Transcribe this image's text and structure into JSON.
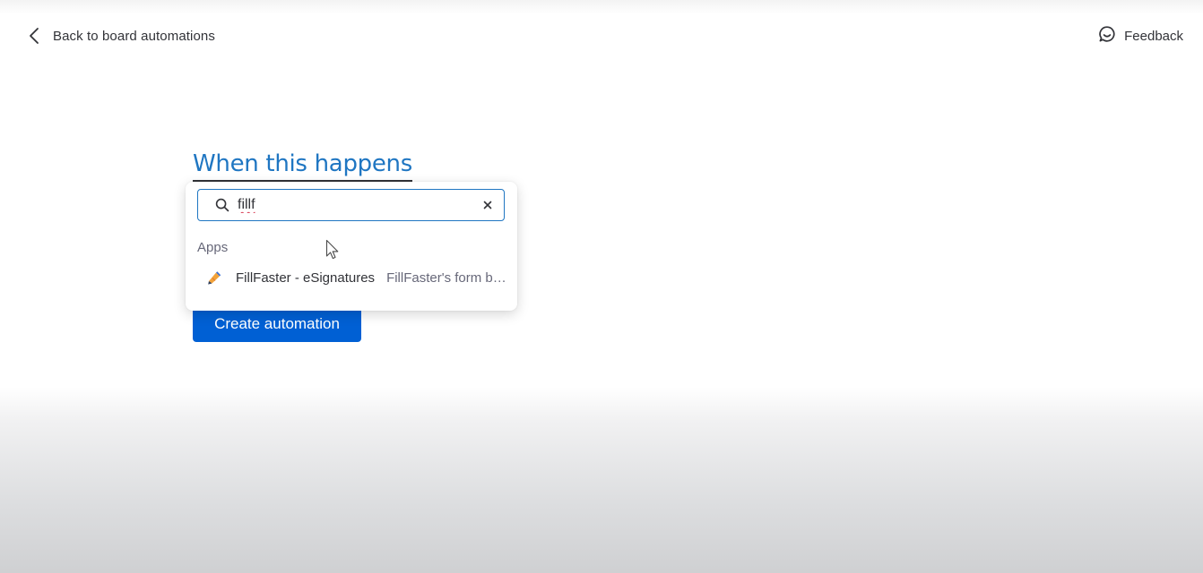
{
  "header": {
    "back_label": "Back to board automations",
    "feedback_label": "Feedback"
  },
  "main": {
    "heading": "When this happens",
    "create_button_label": "Create automation"
  },
  "search_dropdown": {
    "query": "fillf",
    "section_label": "Apps",
    "results": [
      {
        "name": "FillFaster - eSignatures",
        "description": "FillFaster's form builder and eSignatures",
        "icon": "fillfaster-app-icon"
      }
    ]
  },
  "icons": {
    "back": "chevron-left-icon",
    "feedback": "chat-bubble-icon",
    "search": "search-icon",
    "clear": "close-icon"
  },
  "colors": {
    "heading": "#1f76c2",
    "primary_button": "#0060d4",
    "focus_border": "#1f76c2",
    "text": "#323338",
    "secondary_text": "#676879"
  }
}
